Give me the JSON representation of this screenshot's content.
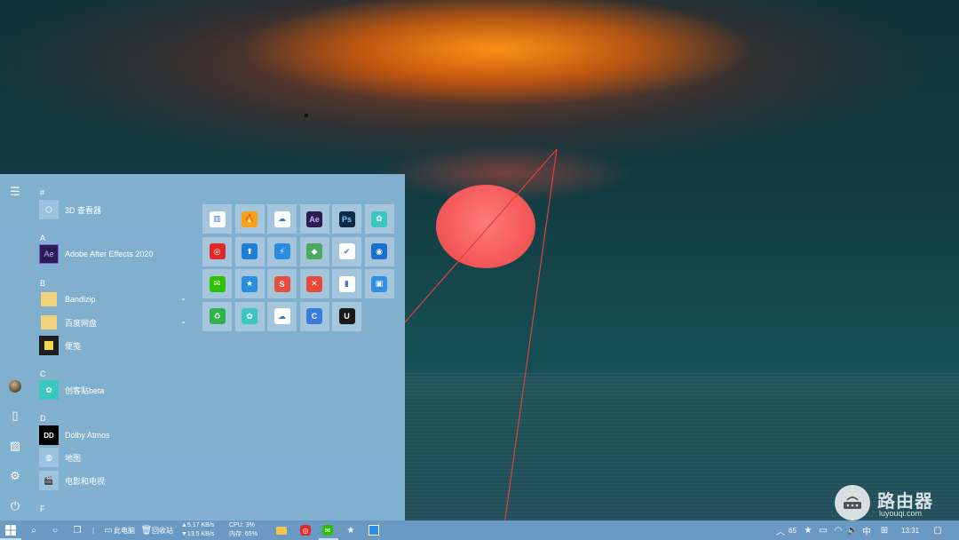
{
  "start_menu": {
    "sections": [
      {
        "header": "#",
        "items": [
          {
            "label": "3D 查看器",
            "icon": "cube-icon"
          }
        ]
      },
      {
        "header": "A",
        "items": [
          {
            "label": "Adobe After Effects 2020",
            "icon": "after-effects-icon",
            "tile_text": "Ae"
          }
        ]
      },
      {
        "header": "B",
        "items": [
          {
            "label": "Bandizip",
            "icon": "folder-icon"
          },
          {
            "label": "百度网盘",
            "icon": "folder-icon"
          },
          {
            "label": "便笺",
            "icon": "sticky-notes-icon"
          }
        ]
      },
      {
        "header": "C",
        "items": [
          {
            "label": "创客贴beta",
            "icon": "chuangketie-icon"
          }
        ]
      },
      {
        "header": "D",
        "items": [
          {
            "label": "Dolby Atmos",
            "icon": "dolby-icon",
            "tile_text": "DD"
          },
          {
            "label": "地图",
            "icon": "maps-icon"
          },
          {
            "label": "电影和电视",
            "icon": "movies-tv-icon"
          }
        ]
      },
      {
        "header": "F",
        "items": []
      }
    ],
    "tiles": [
      {
        "icon": "bar-chart-app-icon",
        "color": "#ffffff",
        "text": "▥"
      },
      {
        "icon": "flame-app-icon",
        "color": "#f7a21b",
        "text": "🔥"
      },
      {
        "icon": "baidu-netdisk-icon",
        "color": "#ffffff",
        "text": "☁"
      },
      {
        "icon": "after-effects-icon",
        "color": "#2a1d4f",
        "text": "Ae"
      },
      {
        "icon": "photoshop-icon",
        "color": "#0b2b45",
        "text": "Ps"
      },
      {
        "icon": "chuangketie-icon",
        "color": "#3bc6c0",
        "text": "✿"
      },
      {
        "icon": "netease-music-icon",
        "color": "#e02a2a",
        "text": "◎"
      },
      {
        "icon": "arrow-up-app-icon",
        "color": "#1f7fd6",
        "text": "⬆"
      },
      {
        "icon": "thunder-icon",
        "color": "#2a8de0",
        "text": "⚡"
      },
      {
        "icon": "diamond-app-icon",
        "color": "#4ea85f",
        "text": "◆"
      },
      {
        "icon": "feishu-icon",
        "color": "#ffffff",
        "text": "✔"
      },
      {
        "icon": "qq-browser-icon",
        "color": "#1a6fd0",
        "text": "◉"
      },
      {
        "icon": "wechat-icon",
        "color": "#2dc100",
        "text": "✉"
      },
      {
        "icon": "star-app-icon",
        "color": "#2a8de0",
        "text": "★"
      },
      {
        "icon": "s-app-icon",
        "color": "#e84d3d",
        "text": "S"
      },
      {
        "icon": "x-app-icon",
        "color": "#e8493a",
        "text": "✕"
      },
      {
        "icon": "bookmark-app-icon",
        "color": "#ffffff",
        "text": "▮"
      },
      {
        "icon": "image-app-icon",
        "color": "#2f8fe0",
        "text": "▣"
      },
      {
        "icon": "recycle-app-icon",
        "color": "#2db34a",
        "text": "♻"
      },
      {
        "icon": "chuangketie-icon",
        "color": "#3bc6c0",
        "text": "✿"
      },
      {
        "icon": "cloud-app-icon",
        "color": "#ffffff",
        "text": "☁"
      },
      {
        "icon": "c-app-icon",
        "color": "#3a7be0",
        "text": "C"
      },
      {
        "icon": "u-app-icon",
        "color": "#1a1a1a",
        "text": "U"
      }
    ]
  },
  "taskbar": {
    "this_pc": "此电脑",
    "recycle_bin": "回收站",
    "upload_speed": "▲5.17 KB/s",
    "download_speed": "▼13.5 KB/s",
    "cpu_label": "CPU:",
    "cpu_value": "3%",
    "mem_label": "内存:",
    "mem_value": "65%",
    "tray_number": "65",
    "ime_lang": "中",
    "clock": "13:31"
  },
  "watermark": {
    "brand": "路由器",
    "url": "luyouqi.com"
  },
  "colors": {
    "start_bg": "#86b4d4",
    "taskbar_bg": "#6a99c4",
    "arrow": "#e0403a"
  }
}
